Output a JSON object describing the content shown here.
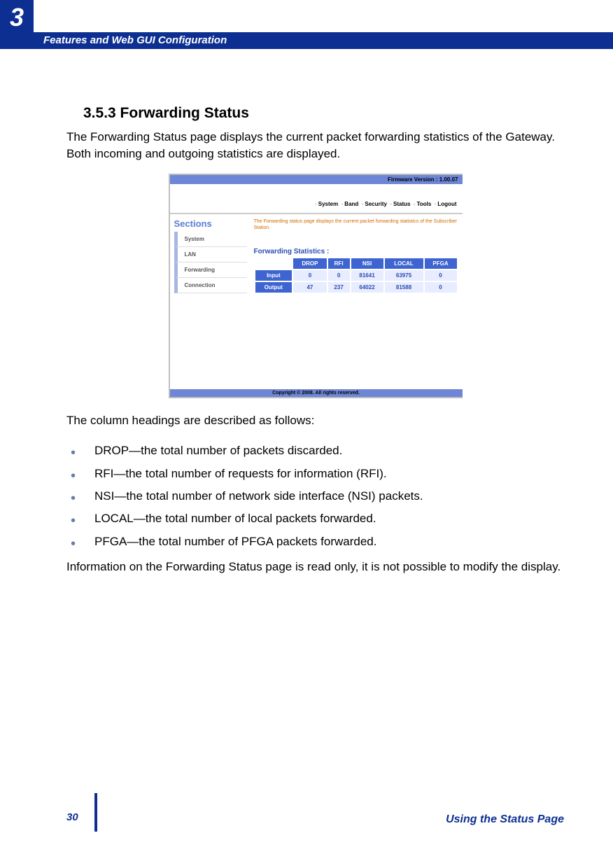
{
  "chapter_number": "3",
  "header_title": "Features and Web GUI Configuration",
  "section_heading": "3.5.3 Forwarding Status",
  "intro_para": "The Forwarding Status page displays the current packet forwarding statistics of the Gateway. Both incoming and outgoing statistics are displayed.",
  "col_heading_intro": "The column headings are described as follows:",
  "bullets": [
    "DROP—the total number of packets discarded.",
    "RFI—the total number of requests for information (RFI).",
    "NSI—the total number of network side interface (NSI) packets.",
    "LOCAL—the total number of local packets forwarded.",
    "PFGA—the total number of PFGA packets forwarded."
  ],
  "closing_para": "Information on the Forwarding Status page is read only, it is not possible to modify the display.",
  "page_number": "30",
  "footer_text": "Using the Status Page",
  "shot": {
    "firmware": "Firmware Version : 1.00.07",
    "nav": [
      "System",
      "Band",
      "Security",
      "Status",
      "Tools",
      "Logout"
    ],
    "sidebar_title": "Sections",
    "sidebar_items": [
      "System",
      "LAN",
      "Forwarding",
      "Connection"
    ],
    "desc": "The Forwarding status page displays the current packet forwarding statistics of the Subscriber Station.",
    "stats_title": "Forwarding Statistics :",
    "table": {
      "cols": [
        "DROP",
        "RFI",
        "NSI",
        "LOCAL",
        "PFGA"
      ],
      "rows": [
        {
          "label": "Input",
          "vals": [
            "0",
            "0",
            "81641",
            "63975",
            "0"
          ]
        },
        {
          "label": "Output",
          "vals": [
            "47",
            "237",
            "64022",
            "81588",
            "0"
          ]
        }
      ]
    },
    "copyright": "Copyright © 2008. All rights reserved."
  }
}
